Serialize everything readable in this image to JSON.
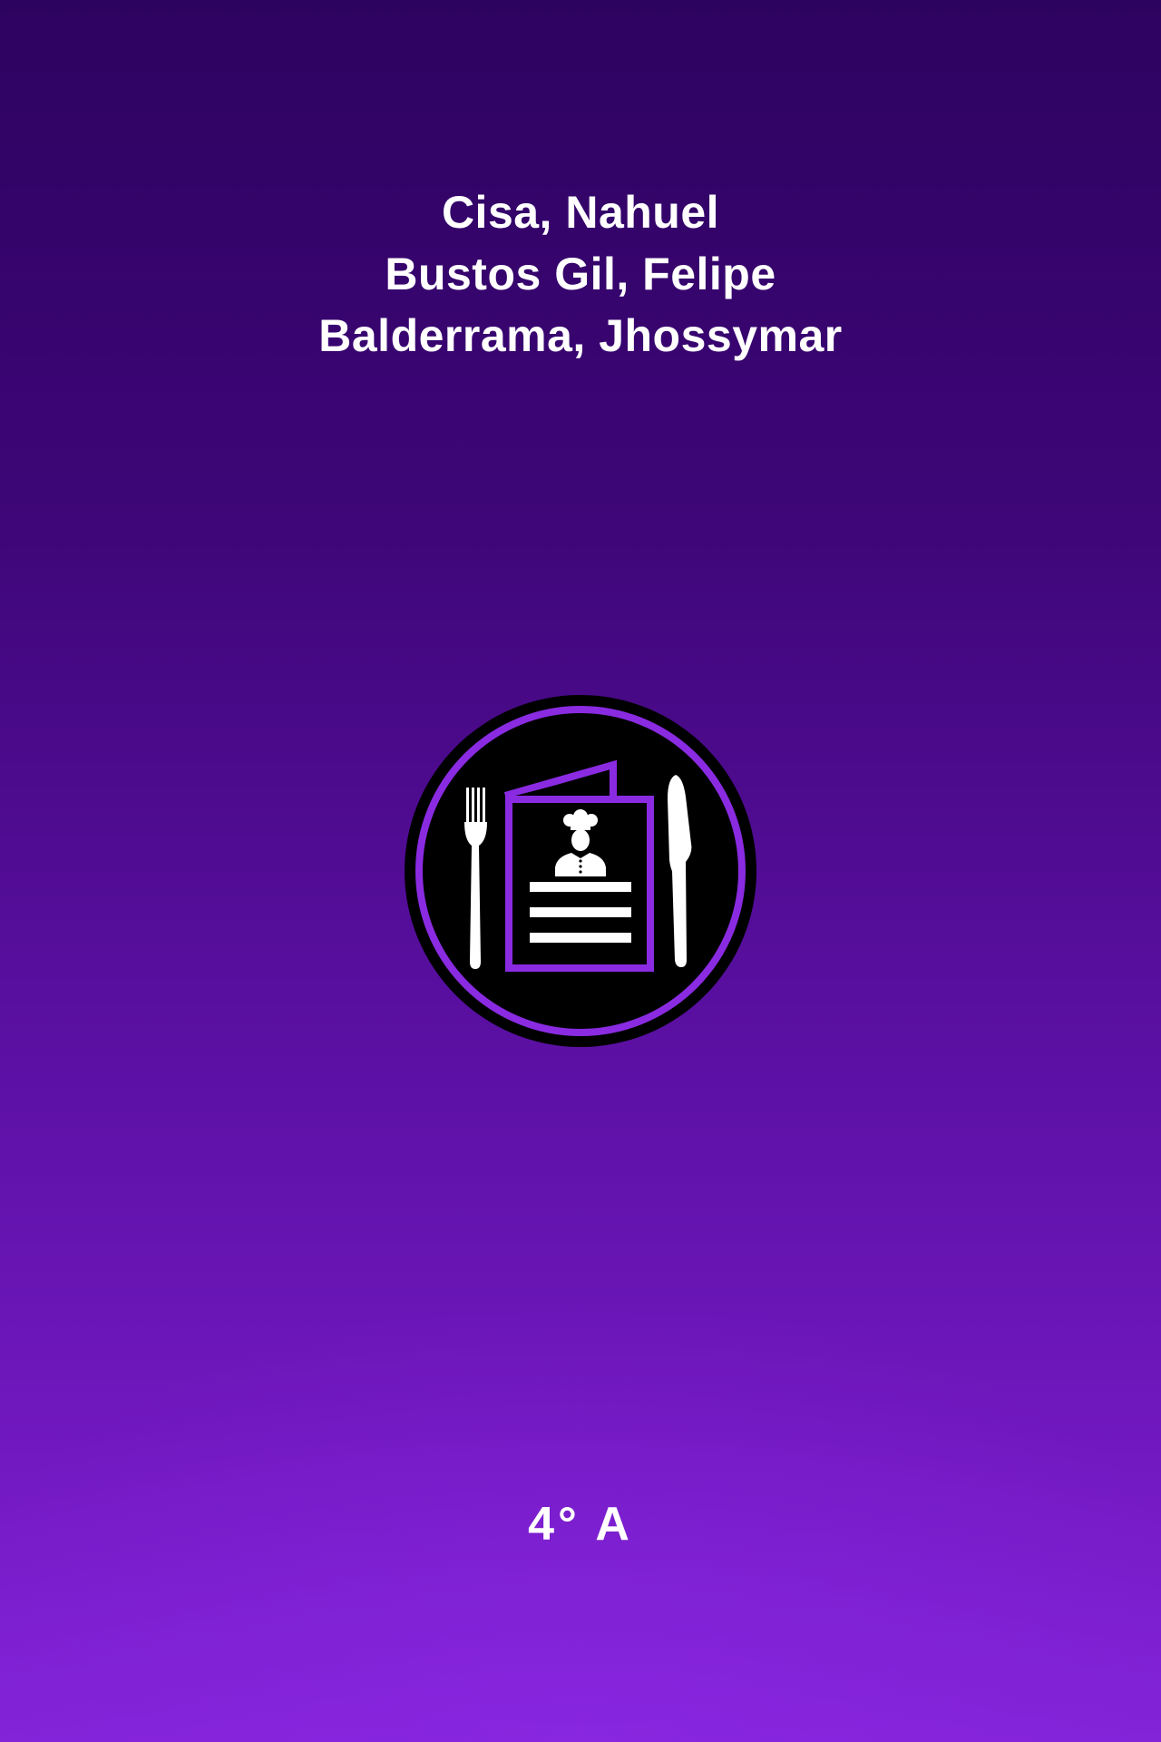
{
  "authors": [
    "Cisa, Nahuel",
    "Bustos Gil, Felipe",
    "Balderrama, Jhossymar"
  ],
  "logo": {
    "icon": "restaurant-menu-icon",
    "accent_color": "#8a2be2",
    "badge_color": "#000000"
  },
  "grade_label": "4° A",
  "background": {
    "top_color": "#2d0360",
    "bottom_color": "#8323d8"
  }
}
